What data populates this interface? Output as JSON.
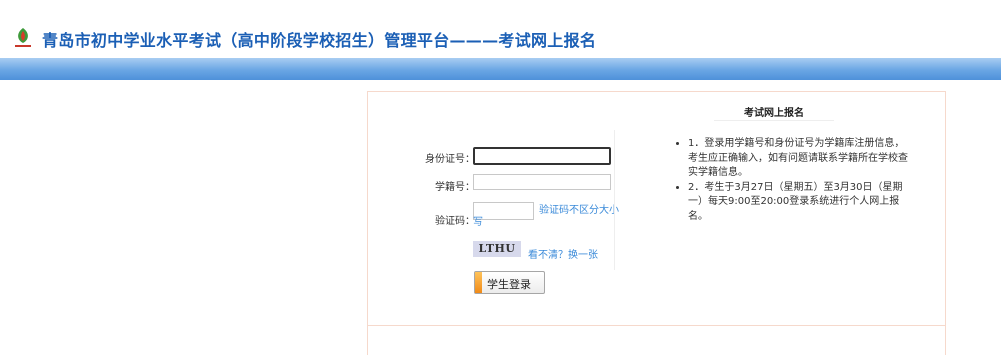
{
  "header": {
    "title": "青岛市初中学业水平考试（高中阶段学校招生）管理平台———考试网上报名",
    "logo_icon": "leaf-logo-icon",
    "band_color": "#6aa6e4"
  },
  "form": {
    "id_label": "身份证号：",
    "id_value": "",
    "student_no_label": "学籍号：",
    "student_no_value": "",
    "captcha_label": "验证码：",
    "captcha_value": "",
    "captcha_hint": "验证码不区分大小写",
    "captcha_image_text": "LTHU",
    "refresh_link": "看不清？换一张",
    "login_button": "学生登录"
  },
  "notice": {
    "title": "考试网上报名",
    "items": [
      "1．登录用学籍号和身份证号为学籍库注册信息，考生应正确输入，如有问题请联系学籍所在学校查实学籍信息。",
      "2．考生于3月27日（星期五）至3月30日（星期一）每天9:00至20:00登录系统进行个人网上报名。"
    ]
  },
  "colors": {
    "title": "#1b5fb5",
    "link": "#3a8ad9",
    "panel_border": "#f6d9cc",
    "button_accent": "#f08a18"
  }
}
